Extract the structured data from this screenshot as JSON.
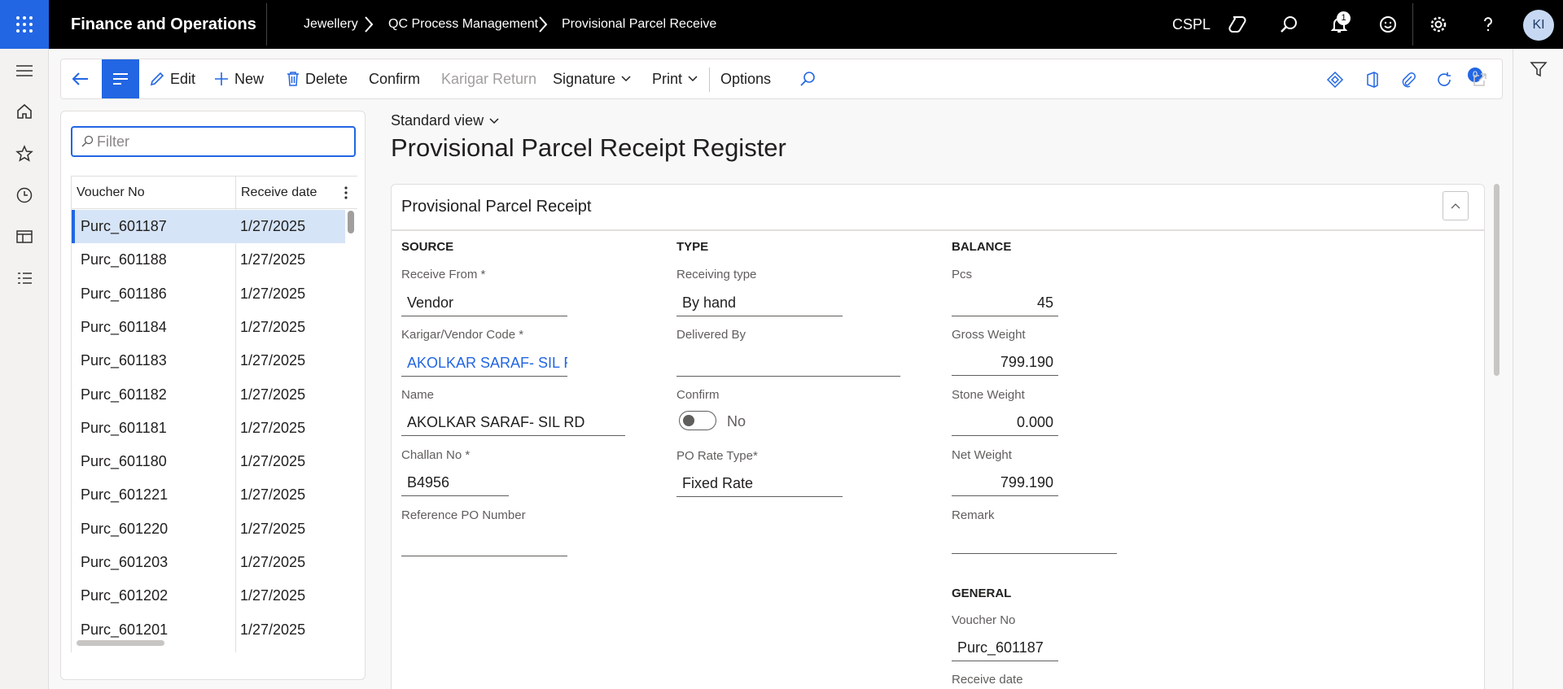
{
  "topbar": {
    "app_title": "Finance and Operations",
    "breadcrumbs": [
      "Jewellery",
      "QC Process Management",
      "Provisional Parcel Receive"
    ],
    "company": "CSPL",
    "notification_count": "1",
    "user_initials": "KI",
    "icons": [
      "waffle-icon",
      "copilot-icon",
      "search-icon",
      "bell-icon",
      "smiley-icon",
      "gear-icon",
      "help-icon"
    ]
  },
  "leftnav": {
    "icons": [
      "hamburger-icon",
      "home-icon",
      "star-icon",
      "clock-icon",
      "workspace-icon",
      "modules-icon"
    ]
  },
  "actionpane": {
    "edit": "Edit",
    "new": "New",
    "delete": "Delete",
    "confirm": "Confirm",
    "karigar_return": "Karigar Return",
    "signature": "Signature",
    "print": "Print",
    "options": "Options",
    "attachments_count": "0"
  },
  "listpane": {
    "filter_placeholder": "Filter",
    "columns": [
      "Voucher No",
      "Receive date"
    ],
    "rows": [
      {
        "voucher": "Purc_601187",
        "date": "1/27/2025"
      },
      {
        "voucher": "Purc_601188",
        "date": "1/27/2025"
      },
      {
        "voucher": "Purc_601186",
        "date": "1/27/2025"
      },
      {
        "voucher": "Purc_601184",
        "date": "1/27/2025"
      },
      {
        "voucher": "Purc_601183",
        "date": "1/27/2025"
      },
      {
        "voucher": "Purc_601182",
        "date": "1/27/2025"
      },
      {
        "voucher": "Purc_601181",
        "date": "1/27/2025"
      },
      {
        "voucher": "Purc_601180",
        "date": "1/27/2025"
      },
      {
        "voucher": "Purc_601221",
        "date": "1/27/2025"
      },
      {
        "voucher": "Purc_601220",
        "date": "1/27/2025"
      },
      {
        "voucher": "Purc_601203",
        "date": "1/27/2025"
      },
      {
        "voucher": "Purc_601202",
        "date": "1/27/2025"
      },
      {
        "voucher": "Purc_601201",
        "date": "1/27/2025"
      }
    ]
  },
  "main": {
    "view_name": "Standard view",
    "page_title": "Provisional Parcel Receipt Register",
    "card_title": "Provisional Parcel Receipt",
    "source": {
      "heading": "SOURCE",
      "receive_from_label": "Receive From *",
      "receive_from": "Vendor",
      "vendor_code_label": "Karigar/Vendor Code *",
      "vendor_code": "AKOLKAR SARAF- SIL R",
      "name_label": "Name",
      "name": "AKOLKAR SARAF- SIL RD",
      "challan_label": "Challan No *",
      "challan": "B4956",
      "ref_po_label": "Reference PO Number",
      "ref_po": ""
    },
    "type": {
      "heading": "TYPE",
      "receiving_type_label": "Receiving type",
      "receiving_type": "By hand",
      "delivered_by_label": "Delivered By",
      "delivered_by": "",
      "confirm_label": "Confirm",
      "confirm_value": "No",
      "po_rate_type_label": "PO Rate Type*",
      "po_rate_type": "Fixed Rate"
    },
    "balance": {
      "heading": "BALANCE",
      "pcs_label": "Pcs",
      "pcs": "45",
      "gross_label": "Gross Weight",
      "gross": "799.190",
      "stone_label": "Stone Weight",
      "stone": "0.000",
      "net_label": "Net Weight",
      "net": "799.190",
      "remark_label": "Remark",
      "remark": ""
    },
    "general": {
      "heading": "GENERAL",
      "voucher_label": "Voucher No",
      "voucher": "Purc_601187",
      "receive_date_label": "Receive date"
    }
  }
}
